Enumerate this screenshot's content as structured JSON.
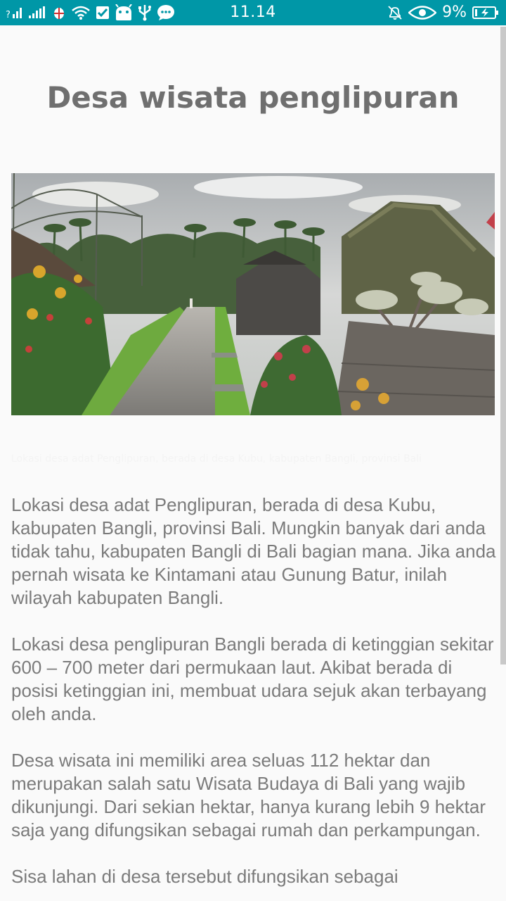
{
  "status_bar": {
    "time": "11.14",
    "battery_percent": "9%",
    "background_color": "#0097a7",
    "icons": [
      "signal-icon",
      "signal-strength-icon",
      "bug-icon",
      "wifi-icon",
      "checkbox-icon",
      "android-icon",
      "usb-icon",
      "chat-icon",
      "mute-bell-icon",
      "eye-icon",
      "battery-icon"
    ]
  },
  "article": {
    "title": "Desa wisata penglipuran",
    "image_caption": "Lokasi desa adat Penglipuran, berada di desa Kubu, kabupaten Bangli, provinsi Bali",
    "paragraphs": [
      "Lokasi desa adat Penglipuran, berada di desa Kubu, kabupaten Bangli, provinsi Bali. Mungkin banyak dari anda tidak tahu, kabupaten Bangli di Bali bagian mana. Jika anda pernah wisata ke Kintamani atau Gunung Batur, inilah wilayah kabupaten Bangli.",
      "Lokasi desa penglipuran Bangli berada di ketinggian sekitar 600 – 700 meter dari permukaan laut. Akibat berada di posisi ketinggian ini, membuat udara sejuk akan terbayang oleh anda.",
      "Desa wisata ini memiliki area seluas 112 hektar dan merupakan salah satu Wisata Budaya di Bali yang wajib dikunjungi. Dari sekian hektar, hanya kurang lebih 9 hektar saja yang difungsikan sebagai rumah dan perkampungan.",
      "Sisa lahan di desa tersebut difungsikan sebagai"
    ]
  }
}
